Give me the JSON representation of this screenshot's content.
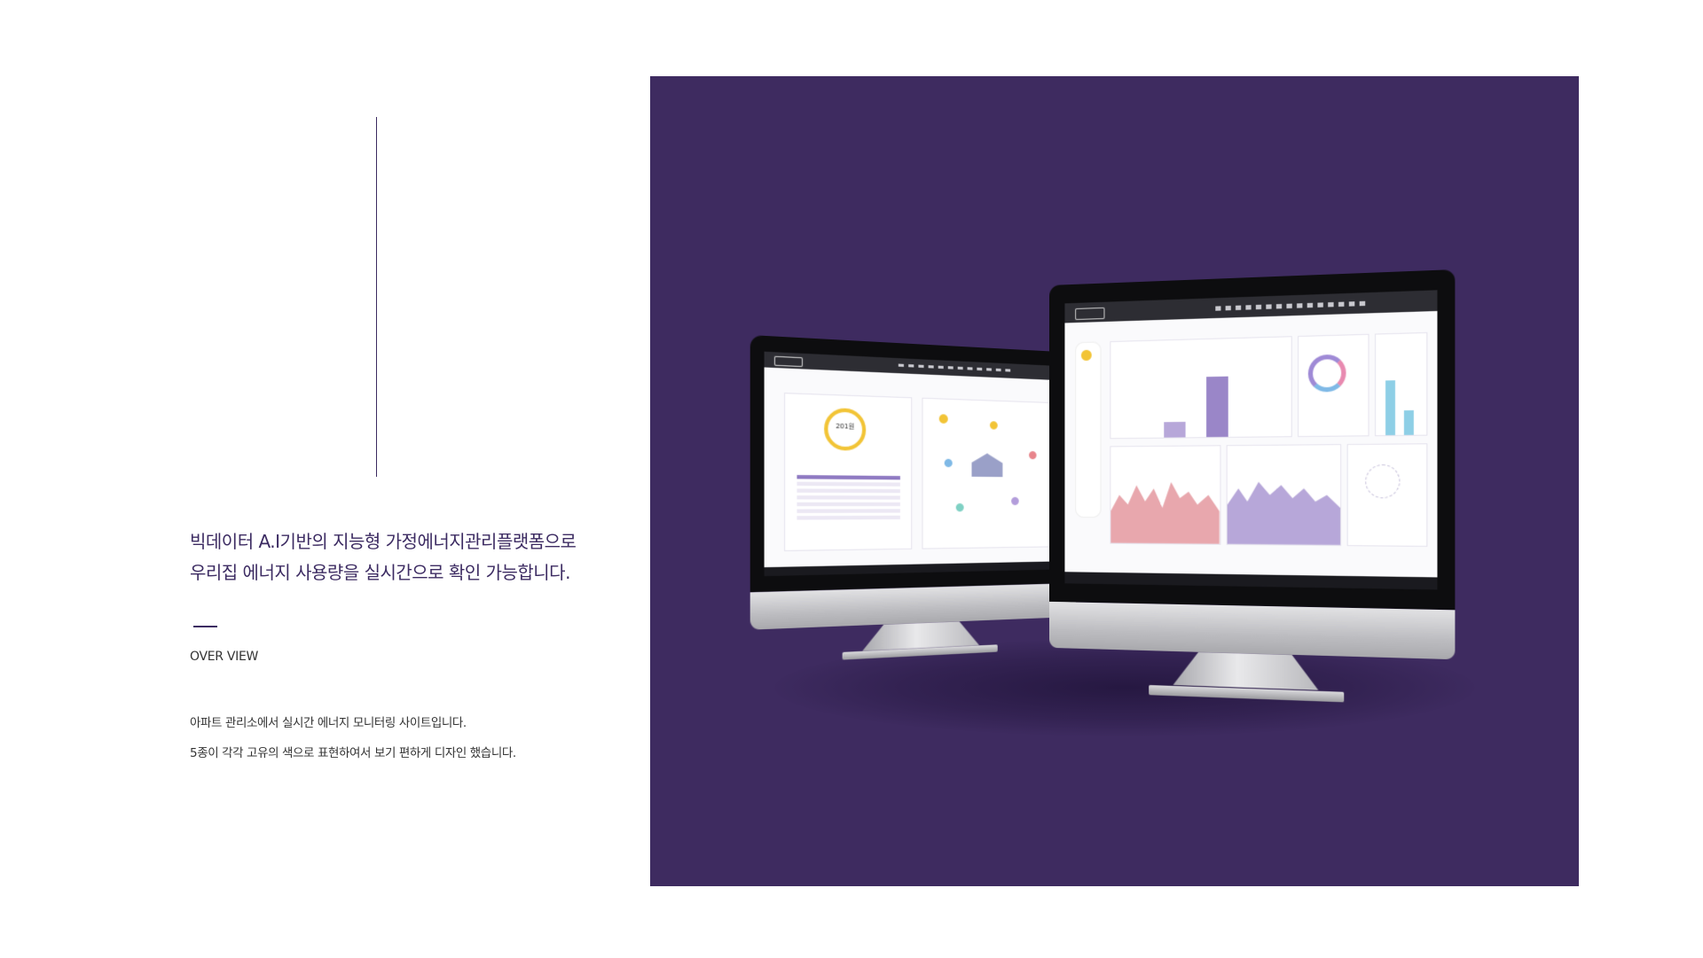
{
  "headline": {
    "line1": "빅데이터 A.I기반의 지능형 가정에너지관리플랫폼으로",
    "line2": "우리집 에너지 사용량을 실시간으로 확인 가능합니다."
  },
  "overview": {
    "label": "OVER VIEW",
    "desc1": "아파트 관리소에서 실시간 에너지 모니터링 사이트입니다.",
    "desc2": "5종이 각각 고유의 색으로 표현하여서 보기 편하게 디자인 했습니다."
  },
  "colors": {
    "accent": "#3e2b60",
    "panel": "#3e2b60",
    "chart_purple": "#b7a7d9",
    "chart_red": "#e8a7ad",
    "chart_blue": "#8ecfe6",
    "yellow": "#f2c436"
  },
  "mockup": {
    "left_screen_title": "",
    "right_screen_title": "",
    "left_center_value": "201원"
  },
  "icons": {
    "apple_logo": "apple-logo-icon"
  }
}
